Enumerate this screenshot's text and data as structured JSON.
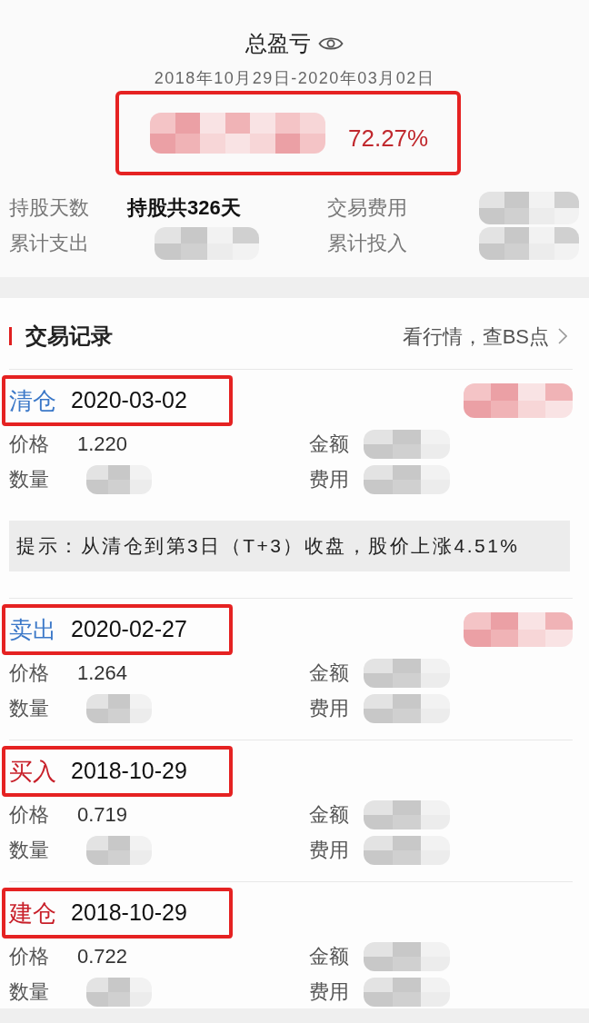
{
  "summary": {
    "title": "总盈亏",
    "date_range": "2018年10月29日-2020年03月02日",
    "highlighted": true,
    "amount_redacted": true,
    "return_rate": "72.27%",
    "stats": [
      {
        "label": "持股天数",
        "value": "持股共326天"
      },
      {
        "label": "交易费用",
        "redacted": true
      },
      {
        "label": "累计支出",
        "redacted": true
      },
      {
        "label": "累计投入",
        "redacted": true
      }
    ]
  },
  "trade_records": {
    "title": "交易记录",
    "link": "看行情，查BS点",
    "records": [
      {
        "action": "清仓",
        "kind": "sell",
        "date": "2020-03-02",
        "highlighted": true,
        "profit_redacted": true,
        "fields": [
          {
            "label": "价格",
            "value": "1.220"
          },
          {
            "label": "金额",
            "redacted": true
          },
          {
            "label": "数量",
            "redacted": true
          },
          {
            "label": "费用",
            "redacted": true
          }
        ],
        "hint": "提示：从清仓到第3日（T+3）收盘，股价上涨4.51%"
      },
      {
        "action": "卖出",
        "kind": "sell",
        "date": "2020-02-27",
        "highlighted": true,
        "profit_redacted": true,
        "fields": [
          {
            "label": "价格",
            "value": "1.264"
          },
          {
            "label": "金额",
            "redacted": true
          },
          {
            "label": "数量",
            "redacted": true
          },
          {
            "label": "费用",
            "redacted": true
          }
        ]
      },
      {
        "action": "买入",
        "kind": "buy",
        "date": "2018-10-29",
        "highlighted": true,
        "fields": [
          {
            "label": "价格",
            "value": "0.719"
          },
          {
            "label": "金额",
            "redacted": true
          },
          {
            "label": "数量",
            "redacted": true
          },
          {
            "label": "费用",
            "redacted": true
          }
        ]
      },
      {
        "action": "建仓",
        "kind": "buy",
        "date": "2018-10-29",
        "highlighted": true,
        "fields": [
          {
            "label": "价格",
            "value": "0.722"
          },
          {
            "label": "金额",
            "redacted": true
          },
          {
            "label": "数量",
            "redacted": true
          },
          {
            "label": "费用",
            "redacted": true
          }
        ]
      }
    ]
  }
}
